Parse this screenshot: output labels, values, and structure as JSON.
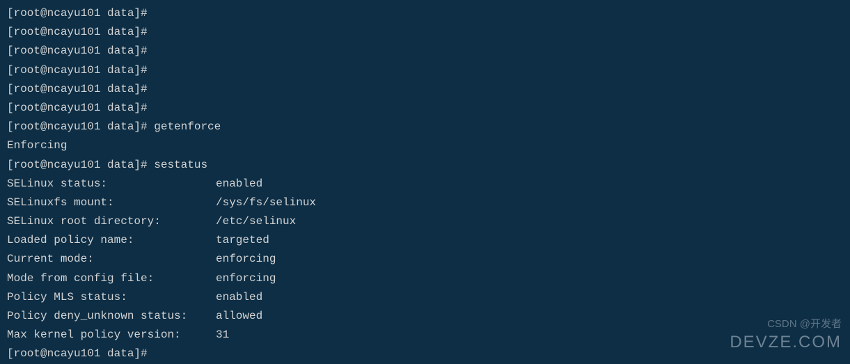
{
  "prompt": "[root@ncayu101 data]#",
  "empty_prompt_count": 6,
  "commands": {
    "getenforce": {
      "cmd": "getenforce",
      "output": "Enforcing"
    },
    "sestatus": {
      "cmd": "sestatus",
      "rows": [
        {
          "key": "SELinux status:",
          "value": "enabled"
        },
        {
          "key": "SELinuxfs mount:",
          "value": "/sys/fs/selinux"
        },
        {
          "key": "SELinux root directory:",
          "value": "/etc/selinux"
        },
        {
          "key": "Loaded policy name:",
          "value": "targeted"
        },
        {
          "key": "Current mode:",
          "value": "enforcing"
        },
        {
          "key": "Mode from config file:",
          "value": "enforcing"
        },
        {
          "key": "Policy MLS status:",
          "value": "enabled"
        },
        {
          "key": "Policy deny_unknown status:",
          "value": "allowed"
        },
        {
          "key": "Max kernel policy version:",
          "value": "31"
        }
      ]
    }
  },
  "watermark": {
    "line1": "CSDN @开发者",
    "line2": "DEVZE.COM"
  }
}
